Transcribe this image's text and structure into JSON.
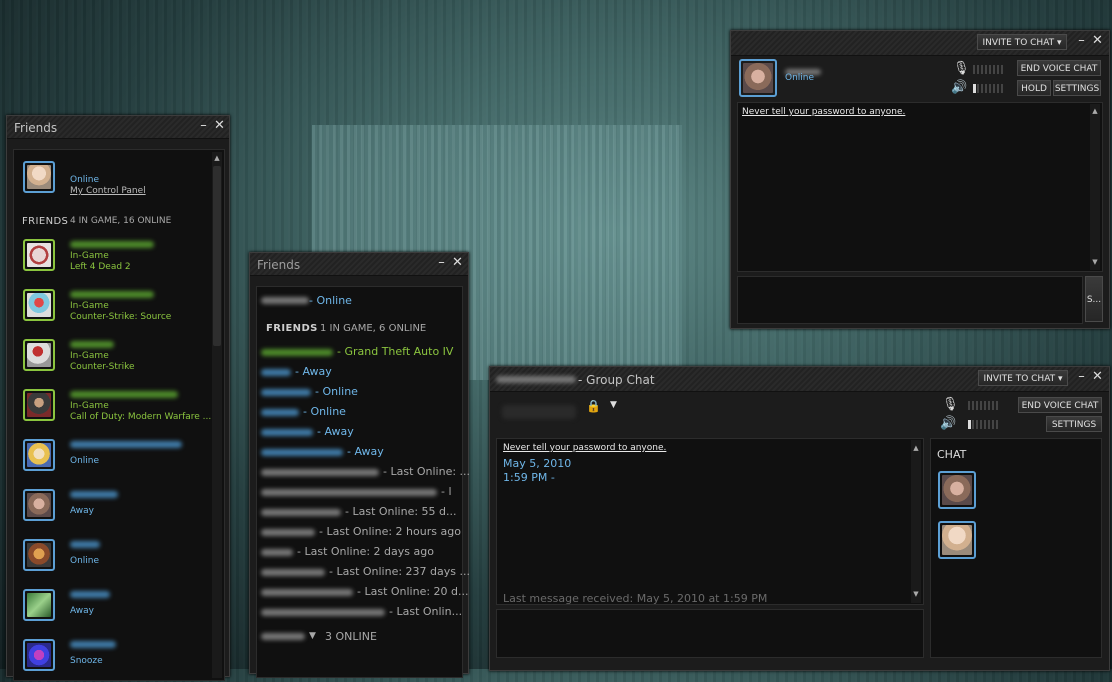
{
  "friends_win": {
    "title": "Friends",
    "self": {
      "status": "Online",
      "control_panel": "My Control Panel"
    },
    "section": {
      "label": "FRIENDS",
      "counts": "4 IN GAME, 16 ONLINE"
    },
    "items": [
      {
        "status": "In-Game",
        "detail": "Left 4 Dead 2"
      },
      {
        "status": "In-Game",
        "detail": "Counter-Strike: Source"
      },
      {
        "status": "In-Game",
        "detail": "Counter-Strike"
      },
      {
        "status": "In-Game",
        "detail": "Call of Duty: Modern Warfare ..."
      },
      {
        "status": "Online",
        "detail": ""
      },
      {
        "status": "Away",
        "detail": ""
      },
      {
        "status": "Online",
        "detail": ""
      },
      {
        "status": "Away",
        "detail": ""
      },
      {
        "status": "Snooze",
        "detail": ""
      }
    ]
  },
  "friends_small": {
    "title": "Friends",
    "self_status": "- Online",
    "section": {
      "label": "FRIENDS",
      "counts": "1 IN GAME, 6 ONLINE"
    },
    "items": [
      {
        "text": "- Grand Theft Auto IV",
        "kind": "ingame"
      },
      {
        "text": "- Away",
        "kind": "online"
      },
      {
        "text": "- Online",
        "kind": "online"
      },
      {
        "text": "- Online",
        "kind": "online"
      },
      {
        "text": "- Away",
        "kind": "online"
      },
      {
        "text": "- Away",
        "kind": "online"
      },
      {
        "text": "- Last Online: ...",
        "kind": "offline"
      },
      {
        "text": "- l",
        "kind": "offline"
      },
      {
        "text": "- Last Online: 55 d...",
        "kind": "offline"
      },
      {
        "text": "- Last Online: 2 hours ago",
        "kind": "offline"
      },
      {
        "text": "- Last Online: 2 days ago",
        "kind": "offline"
      },
      {
        "text": "- Last Online: 237 days ...",
        "kind": "offline"
      },
      {
        "text": "- Last Online: 20 d...",
        "kind": "offline"
      },
      {
        "text": "- Last Onlin...",
        "kind": "offline"
      }
    ],
    "group": "3 ONLINE"
  },
  "voice_chat": {
    "invite": "INVITE TO CHAT",
    "status": "Online",
    "end_voice": "END VOICE CHAT",
    "hold": "HOLD",
    "settings": "SETTINGS",
    "warning": "Never tell your password to anyone.",
    "send_label": "S..."
  },
  "group_chat": {
    "title": "- Group Chat",
    "invite": "INVITE TO CHAT",
    "end_voice": "END VOICE CHAT",
    "settings": "SETTINGS",
    "warning": "Never tell your password to anyone.",
    "date": "May 5, 2010",
    "time": "1:59 PM -",
    "last_message": "Last message received: May 5, 2010 at 1:59 PM",
    "members_label": "CHAT"
  },
  "colors": {
    "online": "#6fb6e8",
    "ingame": "#8bc53f",
    "offline": "#a8a8a8"
  }
}
